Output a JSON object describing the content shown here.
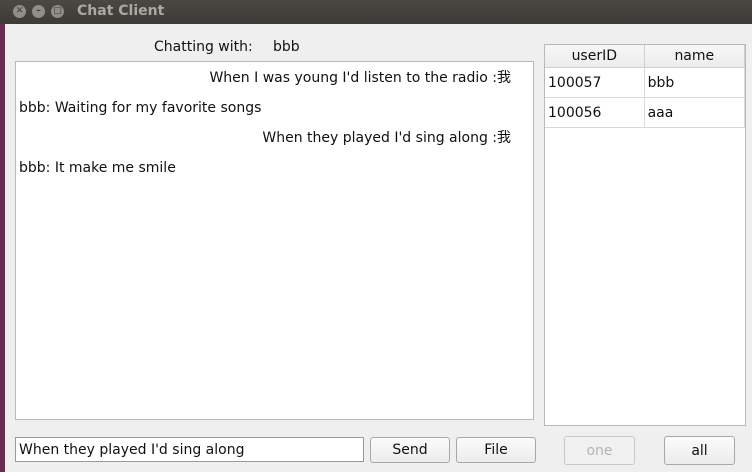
{
  "window": {
    "title": "Chat Client"
  },
  "chat": {
    "with_label": "Chatting with:",
    "with_user": "bbb",
    "messages": [
      {
        "text": "When I was young I'd listen to the radio :我",
        "align": "right"
      },
      {
        "text": "bbb: Waiting for my favorite songs",
        "align": "left"
      },
      {
        "text": "When they played I'd sing along :我",
        "align": "right"
      },
      {
        "text": "bbb: It make me smile",
        "align": "left"
      }
    ]
  },
  "users": {
    "columns": [
      "userID",
      "name"
    ],
    "rows": [
      {
        "userID": "100057",
        "name": "bbb"
      },
      {
        "userID": "100056",
        "name": "aaa"
      }
    ]
  },
  "composer": {
    "value": "When they played I'd sing along"
  },
  "buttons": {
    "send": "Send",
    "file": "File",
    "one": "one",
    "all": "all"
  }
}
